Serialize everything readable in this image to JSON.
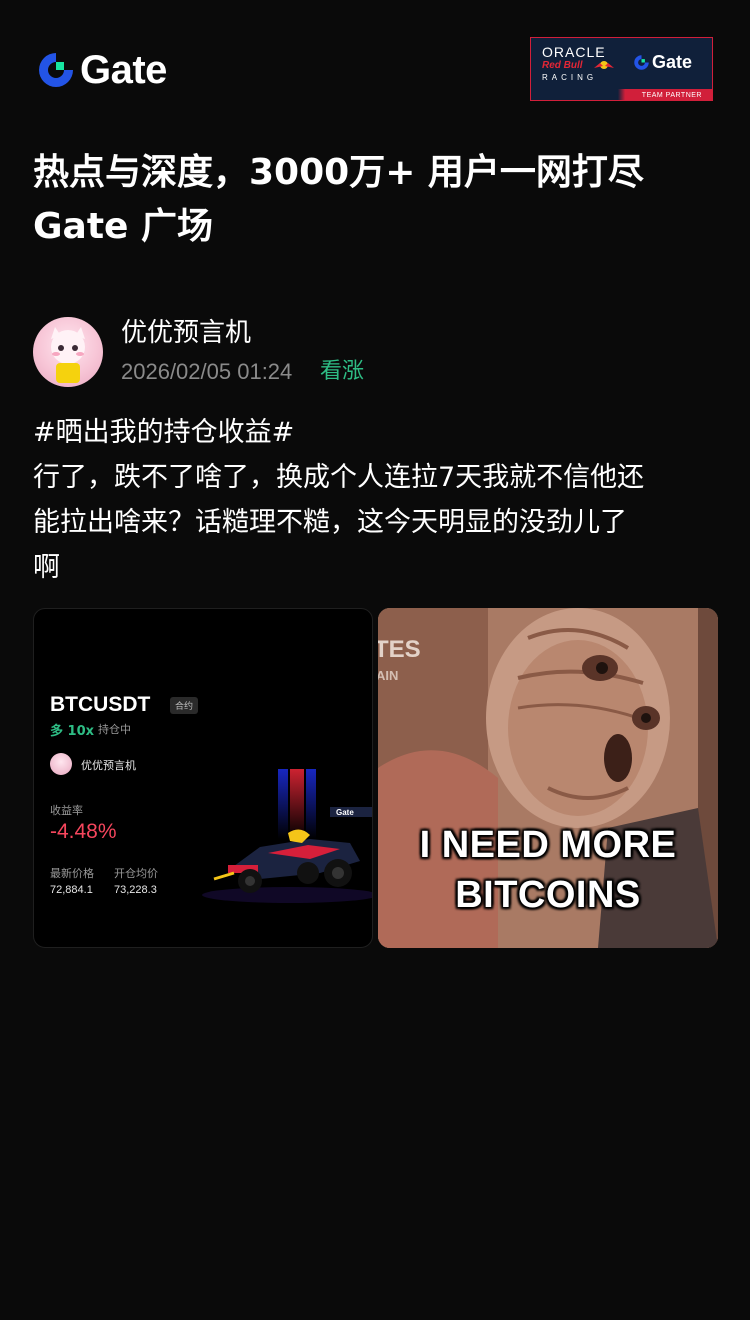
{
  "header": {
    "brand_name": "Gate",
    "partner_badge": {
      "line1": "ORACLE",
      "line2": "Red Bull",
      "line3": "RACING",
      "brand": "Gate",
      "strip_text": "TEAM PARTNER"
    }
  },
  "headline": {
    "line1": "热点与深度，3000万+ 用户一网打尽",
    "line2": "Gate 广场"
  },
  "post": {
    "author": "优优预言机",
    "timestamp": "2026/02/05 01:24",
    "sentiment": "看涨",
    "body_lines": [
      "#晒出我的持仓收益#",
      "行了，跌不了啥了，换成个人连拉7天我就不信他还",
      "能拉出啥来？话糙理不糙，这今天明显的没劲儿了",
      "啊"
    ],
    "pnl_card": {
      "symbol": "BTCUSDT",
      "tag": "合约",
      "side": "多 10x",
      "side_label": "持仓中",
      "username": "优优预言机",
      "roi_label": "收益率",
      "roi": "-4.48%",
      "last_price_label": "最新价格",
      "last_price": "72,884.1",
      "avg_price_label": "开仓均价",
      "avg_price": "73,228.3"
    },
    "meme": {
      "corner_text": "TES",
      "corner_sub": "AIN",
      "caption_line1": "I NEED MORE",
      "caption_line2": "BITCOINS"
    }
  },
  "colors": {
    "background": "#0a0a0a",
    "brand_blue": "#2354e6",
    "brand_green": "#17e6a1",
    "bullish": "#2ebd85",
    "bearish": "#f6465d"
  }
}
